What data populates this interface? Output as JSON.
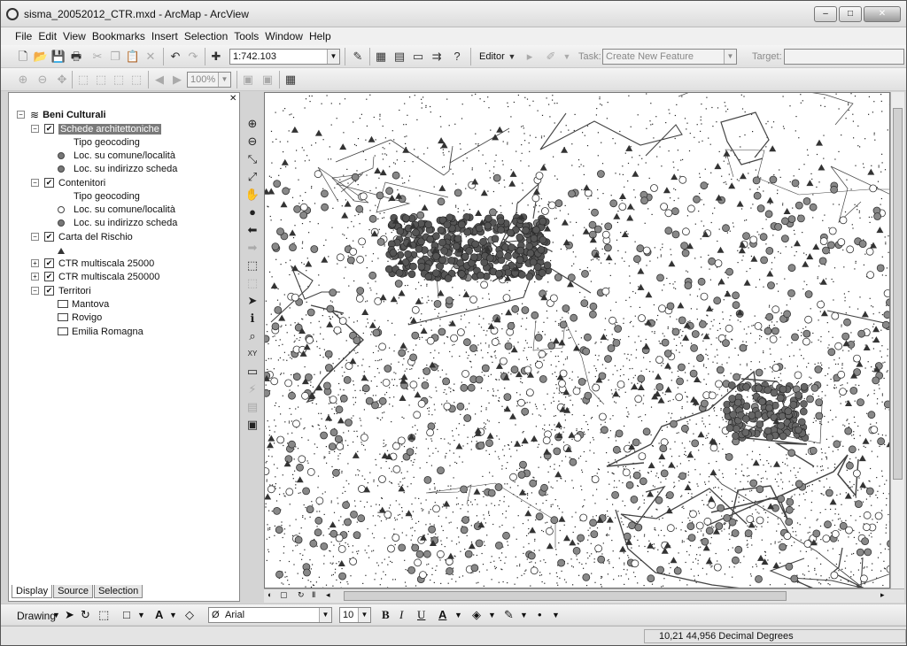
{
  "window": {
    "title": "sisma_20052012_CTR.mxd - ArcMap - ArcView",
    "min": "–",
    "max": "□",
    "close": "✕"
  },
  "menu": [
    "File",
    "Edit",
    "View",
    "Bookmarks",
    "Insert",
    "Selection",
    "Tools",
    "Window",
    "Help"
  ],
  "toolbar": {
    "scale": "1:742.103",
    "editor": "Editor",
    "task_label": "Task:",
    "task_value": "Create New Feature",
    "target_label": "Target:",
    "zoom": "100%"
  },
  "toc": {
    "root": "Beni Culturali",
    "items": [
      {
        "label": "Schede architettoniche"
      },
      {
        "label": "Tipo geocoding"
      },
      {
        "label": "Loc. su comune/località"
      },
      {
        "label": "Loc. su indirizzo scheda"
      },
      {
        "label": "Contenitori"
      },
      {
        "label": "Tipo geocoding"
      },
      {
        "label": "Loc. su comune/località"
      },
      {
        "label": "Loc. su indirizzo scheda"
      },
      {
        "label": "Carta del Rischio"
      },
      {
        "label": "CTR multiscala 25000"
      },
      {
        "label": "CTR multiscala 250000"
      },
      {
        "label": "Territori"
      },
      {
        "label": "Mantova"
      },
      {
        "label": "Rovigo"
      },
      {
        "label": "Emilia Romagna"
      }
    ],
    "tabs": [
      "Display",
      "Source",
      "Selection"
    ]
  },
  "drawing": {
    "label": "Drawing",
    "font": "Arial",
    "size": "10",
    "bold": "B",
    "italic": "I",
    "underline": "U",
    "font_color": "A"
  },
  "status": {
    "coords": "10,21  44,956 Decimal Degrees"
  }
}
